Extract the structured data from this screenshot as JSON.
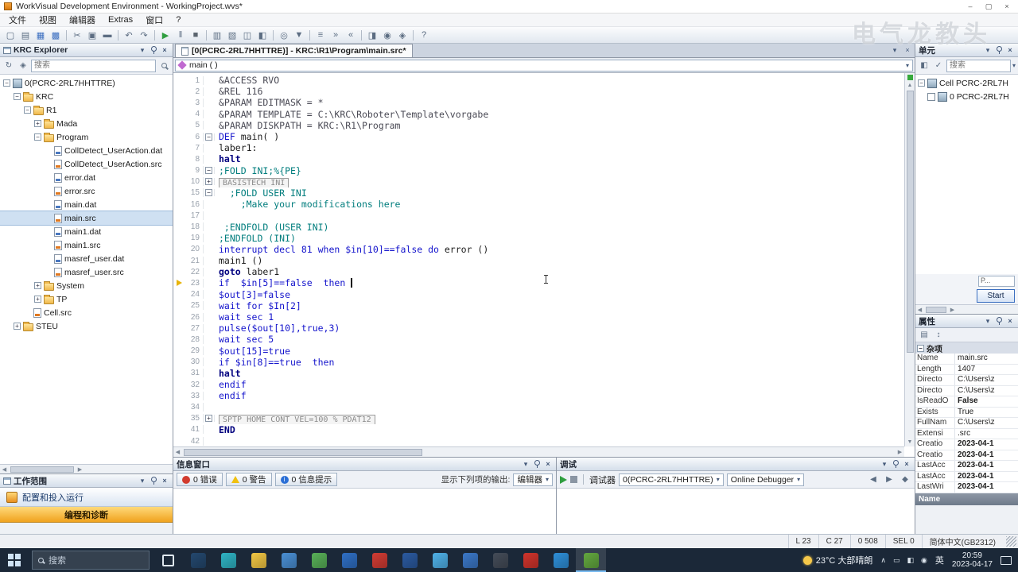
{
  "window": {
    "title": "WorkVisual Development Environment - WorkingProject.wvs*"
  },
  "watermark": "电气龙教头",
  "menu": [
    "文件",
    "视图",
    "编辑器",
    "Extras",
    "窗口",
    "?"
  ],
  "toolbar": {
    "groups": [
      [
        {
          "name": "new-file",
          "g": "▢"
        },
        {
          "name": "open-project",
          "g": "▤"
        },
        {
          "name": "save",
          "g": "▦",
          "cls": "blue"
        },
        {
          "name": "save-all",
          "g": "▩",
          "cls": "blue"
        }
      ],
      [
        {
          "name": "cut",
          "g": "✂"
        },
        {
          "name": "copy",
          "g": "▣"
        },
        {
          "name": "paste",
          "g": "▬"
        }
      ],
      [
        {
          "name": "undo",
          "g": "↶"
        },
        {
          "name": "redo",
          "g": "↷"
        }
      ],
      [
        {
          "name": "run",
          "g": "▶",
          "cls": "green"
        },
        {
          "name": "pause",
          "g": "‖"
        },
        {
          "name": "stop",
          "g": "■",
          "cls": "dark"
        }
      ],
      [
        {
          "name": "add-device",
          "g": "▥"
        },
        {
          "name": "catalog",
          "g": "▧"
        },
        {
          "name": "compare-projects",
          "g": "◫"
        },
        {
          "name": "project-structure",
          "g": "◧"
        }
      ],
      [
        {
          "name": "search",
          "g": "◎"
        },
        {
          "name": "filter",
          "g": "▼"
        }
      ],
      [
        {
          "name": "list-view",
          "g": "≡"
        },
        {
          "name": "indent",
          "g": "»"
        },
        {
          "name": "outdent",
          "g": "«"
        }
      ],
      [
        {
          "name": "monitor",
          "g": "◨"
        },
        {
          "name": "zoom",
          "g": "◉"
        },
        {
          "name": "options",
          "g": "◈"
        }
      ],
      [
        {
          "name": "help",
          "g": "?"
        }
      ]
    ]
  },
  "explorer": {
    "title": "KRC Explorer",
    "search_placeholder": "搜索",
    "tree": [
      {
        "label": "0(PCRC-2RL7HHTTRE)",
        "lv": 0,
        "ic": "root",
        "exp": "-"
      },
      {
        "label": "KRC",
        "lv": 1,
        "ic": "folder",
        "exp": "-"
      },
      {
        "label": "R1",
        "lv": 2,
        "ic": "folder",
        "exp": "-"
      },
      {
        "label": "Mada",
        "lv": 3,
        "ic": "folder",
        "exp": "+"
      },
      {
        "label": "Program",
        "lv": 3,
        "ic": "folder",
        "exp": "-"
      },
      {
        "label": "CollDetect_UserAction.dat",
        "lv": 4,
        "ic": "dat"
      },
      {
        "label": "CollDetect_UserAction.src",
        "lv": 4,
        "ic": "src"
      },
      {
        "label": "error.dat",
        "lv": 4,
        "ic": "dat"
      },
      {
        "label": "error.src",
        "lv": 4,
        "ic": "src"
      },
      {
        "label": "main.dat",
        "lv": 4,
        "ic": "dat"
      },
      {
        "label": "main.src",
        "lv": 4,
        "ic": "src",
        "sel": true
      },
      {
        "label": "main1.dat",
        "lv": 4,
        "ic": "dat"
      },
      {
        "label": "main1.src",
        "lv": 4,
        "ic": "src"
      },
      {
        "label": "masref_user.dat",
        "lv": 4,
        "ic": "dat"
      },
      {
        "label": "masref_user.src",
        "lv": 4,
        "ic": "src"
      },
      {
        "label": "System",
        "lv": 3,
        "ic": "folder",
        "exp": "+"
      },
      {
        "label": "TP",
        "lv": 3,
        "ic": "folder",
        "exp": "+"
      },
      {
        "label": "Cell.src",
        "lv": 2,
        "ic": "src"
      },
      {
        "label": "STEU",
        "lv": 1,
        "ic": "folder",
        "exp": "+"
      }
    ]
  },
  "workspace": {
    "title": "工作范围",
    "items": [
      {
        "label": "配置和投入运行"
      },
      {
        "label": "编程和诊断",
        "active": true
      }
    ]
  },
  "editor": {
    "tab_title": "[0(PCRC-2RL7HHTTRE)] - KRC:\\R1\\Program\\main.src*",
    "selector": "main ( )",
    "lines": [
      {
        "n": "1",
        "s": [
          [
            "a",
            "&ACCESS RVO"
          ]
        ]
      },
      {
        "n": "2",
        "s": [
          [
            "a",
            "&REL 116"
          ]
        ]
      },
      {
        "n": "3",
        "s": [
          [
            "a",
            "&PARAM EDITMASK = *"
          ]
        ]
      },
      {
        "n": "4",
        "s": [
          [
            "a",
            "&PARAM TEMPLATE = C:\\KRC\\Roboter\\Template\\vorgabe"
          ]
        ]
      },
      {
        "n": "5",
        "s": [
          [
            "a",
            "&PARAM DISKPATH = KRC:\\R1\\Program"
          ]
        ]
      },
      {
        "n": "6",
        "fold": "-",
        "s": [
          [
            "k",
            "DEF"
          ],
          [
            "p",
            " main( )"
          ]
        ]
      },
      {
        "n": "7",
        "s": [
          [
            "p",
            "laber1:"
          ]
        ]
      },
      {
        "n": "8",
        "s": [
          [
            "b",
            "halt"
          ]
        ]
      },
      {
        "n": "9",
        "fold": "-",
        "s": [
          [
            "c",
            ";FOLD INI;%{PE}"
          ]
        ]
      },
      {
        "n": "10",
        "fold": "+",
        "s": [
          [
            "f",
            "BASISTECH INI"
          ]
        ]
      },
      {
        "n": "15",
        "fold": "-",
        "s": [
          [
            "c",
            "  ;FOLD USER INI"
          ]
        ]
      },
      {
        "n": "16",
        "s": [
          [
            "c",
            "    ;Make your modifications here"
          ]
        ]
      },
      {
        "n": "17",
        "s": []
      },
      {
        "n": "18",
        "s": [
          [
            "c",
            " ;ENDFOLD (USER INI)"
          ]
        ]
      },
      {
        "n": "19",
        "s": [
          [
            "c",
            ";ENDFOLD (INI)"
          ]
        ]
      },
      {
        "n": "20",
        "s": [
          [
            "k",
            "interrupt decl 81 when $in[10]==false do"
          ],
          [
            "p",
            " error ()"
          ]
        ]
      },
      {
        "n": "21",
        "s": [
          [
            "p",
            "main1 ()"
          ]
        ]
      },
      {
        "n": "22",
        "s": [
          [
            "b",
            "goto"
          ],
          [
            "p",
            " laber1"
          ]
        ]
      },
      {
        "n": "23",
        "m": "arrow",
        "s": [
          [
            "k",
            "if  $in[5]==false  then "
          ],
          [
            "caret",
            ""
          ]
        ]
      },
      {
        "n": "24",
        "s": [
          [
            "k",
            "$out[3]=false"
          ]
        ]
      },
      {
        "n": "25",
        "s": [
          [
            "k",
            "wait for $In[2]"
          ]
        ]
      },
      {
        "n": "26",
        "s": [
          [
            "k",
            "wait sec 1"
          ]
        ]
      },
      {
        "n": "27",
        "s": [
          [
            "k",
            "pulse($out[10],true,3)"
          ]
        ]
      },
      {
        "n": "28",
        "s": [
          [
            "k",
            "wait sec 5"
          ]
        ]
      },
      {
        "n": "29",
        "s": [
          [
            "k",
            "$out[15]=true"
          ]
        ]
      },
      {
        "n": "30",
        "s": [
          [
            "k",
            "if $in[8]==true  then"
          ]
        ]
      },
      {
        "n": "31",
        "s": [
          [
            "b",
            "halt"
          ]
        ]
      },
      {
        "n": "32",
        "s": [
          [
            "k",
            "endif"
          ]
        ]
      },
      {
        "n": "33",
        "s": [
          [
            "k",
            "endif"
          ]
        ]
      },
      {
        "n": "34",
        "s": []
      },
      {
        "n": "35",
        "fold": "+",
        "s": [
          [
            "f",
            "SPTP HOME CONT VEL=100 % PDAT12"
          ]
        ]
      },
      {
        "n": "41",
        "s": [
          [
            "b",
            "END"
          ]
        ]
      },
      {
        "n": "42",
        "s": []
      }
    ]
  },
  "cell": {
    "title": "单元",
    "search_placeholder": "搜索",
    "tree": [
      {
        "label": "Cell PCRC-2RL7H",
        "exp": "-",
        "ic": "cell"
      },
      {
        "label": "0 PCRC-2RL7H",
        "chk": true,
        "ic": "root"
      }
    ],
    "field_text": "P...",
    "start_label": "Start"
  },
  "properties": {
    "title": "属性",
    "category": "杂项",
    "rows": [
      {
        "k": "Name",
        "v": "main.src"
      },
      {
        "k": "Length",
        "v": "1407"
      },
      {
        "k": "Directo",
        "v": "C:\\Users\\z"
      },
      {
        "k": "Directo",
        "v": "C:\\Users\\z"
      },
      {
        "k": "IsReadO",
        "v": "False",
        "b": true
      },
      {
        "k": "Exists",
        "v": "True"
      },
      {
        "k": "FullNam",
        "v": "C:\\Users\\z"
      },
      {
        "k": "Extensi",
        "v": ".src"
      },
      {
        "k": "Creatio",
        "v": "2023-04-1",
        "b": true
      },
      {
        "k": "Creatio",
        "v": "2023-04-1",
        "b": true
      },
      {
        "k": "LastAcc",
        "v": "2023-04-1",
        "b": true
      },
      {
        "k": "LastAcc",
        "v": "2023-04-1",
        "b": true
      },
      {
        "k": "LastWri",
        "v": "2023-04-1",
        "b": true
      }
    ],
    "footer": "Name"
  },
  "info_window": {
    "title": "信息窗口",
    "errors_label": "0 错误",
    "warnings_label": "0 警告",
    "infos_label": "0 信息提示",
    "output_label": "显示下列项的输出:",
    "output_selector": "编辑器"
  },
  "debug": {
    "title": "调试",
    "debugger_label": "调试器",
    "target": "0(PCRC-2RL7HHTTRE)",
    "mode": "Online Debugger"
  },
  "statusbar": {
    "line": "L 23",
    "col": "C 27",
    "offset": "0 508",
    "sel": "SEL 0",
    "encoding": "简体中文(GB2312)"
  },
  "taskbar": {
    "search_placeholder": "搜索",
    "weather": "23°C 大部晴朗",
    "lang": "英",
    "time": "20:59",
    "date": "2023-04-17",
    "icons": [
      {
        "name": "task-view",
        "color": "#ffffff"
      },
      {
        "name": "cad-app",
        "color": "#24486e"
      },
      {
        "name": "edge-browser",
        "color": "#2fb3c4"
      },
      {
        "name": "file-explorer",
        "color": "#f2c744"
      },
      {
        "name": "chrome-browser",
        "color": "#4a8fd4"
      },
      {
        "name": "app-store",
        "color": "#58b058"
      },
      {
        "name": "mail-app",
        "color": "#2f6fc4"
      },
      {
        "name": "netease-music",
        "color": "#d23c34"
      },
      {
        "name": "word-app",
        "color": "#2b5aa0"
      },
      {
        "name": "qq-app",
        "color": "#4fb1e8"
      },
      {
        "name": "cloud-app",
        "color": "#3b78c8"
      },
      {
        "name": "dev-app",
        "color": "#444c58"
      },
      {
        "name": "wps-office",
        "color": "#d0342c"
      },
      {
        "name": "video-app",
        "color": "#2e8fd8"
      },
      {
        "name": "workvisual",
        "color": "#63a83f",
        "active": true
      }
    ],
    "tray": [
      {
        "name": "hidden-icons",
        "g": "∧"
      },
      {
        "name": "display",
        "g": "▭"
      },
      {
        "name": "network",
        "g": "◧"
      },
      {
        "name": "volume",
        "g": "◉"
      }
    ]
  }
}
